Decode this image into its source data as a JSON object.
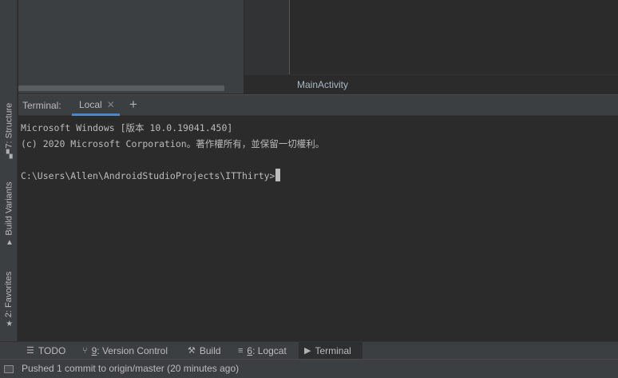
{
  "left_strip": {
    "structure_label": "7: Structure",
    "build_variants_label": "Build Variants",
    "favorites_label": "2: Favorites"
  },
  "editor": {
    "breadcrumb": "MainActivity"
  },
  "terminal": {
    "title": "Terminal:",
    "tab_label": "Local",
    "add_label": "+",
    "lines": [
      "Microsoft Windows [版本 10.0.19041.450]",
      "(c) 2020 Microsoft Corporation。著作權所有，並保留一切權利。",
      "",
      "C:\\Users\\Allen\\AndroidStudioProjects\\ITThirty>"
    ]
  },
  "bottom_tabs": {
    "todo": {
      "label": "TODO"
    },
    "version_control": {
      "num": "9",
      "label": ": Version Control"
    },
    "build": {
      "label": "Build"
    },
    "logcat": {
      "num": "6",
      "label": ": Logcat"
    },
    "terminal": {
      "label": "Terminal"
    }
  },
  "status": {
    "message": "Pushed 1 commit to origin/master (20 minutes ago)"
  },
  "colors": {
    "background": "#2b2b2b",
    "panel": "#3c3f41",
    "accent": "#4a88c7",
    "text": "#bbbbbb"
  },
  "icons": [
    "structure-icon",
    "build-variants-icon",
    "favorites-star-icon",
    "todo-icon",
    "version-control-icon",
    "build-hammer-icon",
    "logcat-icon",
    "terminal-icon",
    "close-icon",
    "add-icon",
    "status-window-icon"
  ]
}
